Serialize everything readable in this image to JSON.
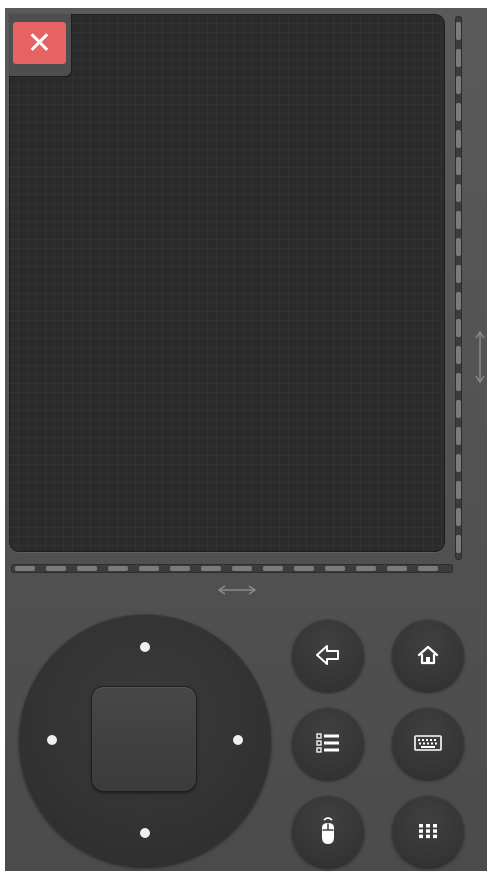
{
  "close_button": {
    "label": "✕",
    "color": "#e76363"
  },
  "controls": {
    "back_icon": "back-arrow-icon",
    "home_icon": "home-icon",
    "menu_icon": "list-menu-icon",
    "keyboard_icon": "keyboard-icon",
    "mouse_icon": "mouse-icon",
    "apps_icon": "grid-apps-icon"
  },
  "colors": {
    "panel": "#555555",
    "touchpad": "#2b2b2b",
    "button": "#363636",
    "icon": "#ffffff"
  }
}
